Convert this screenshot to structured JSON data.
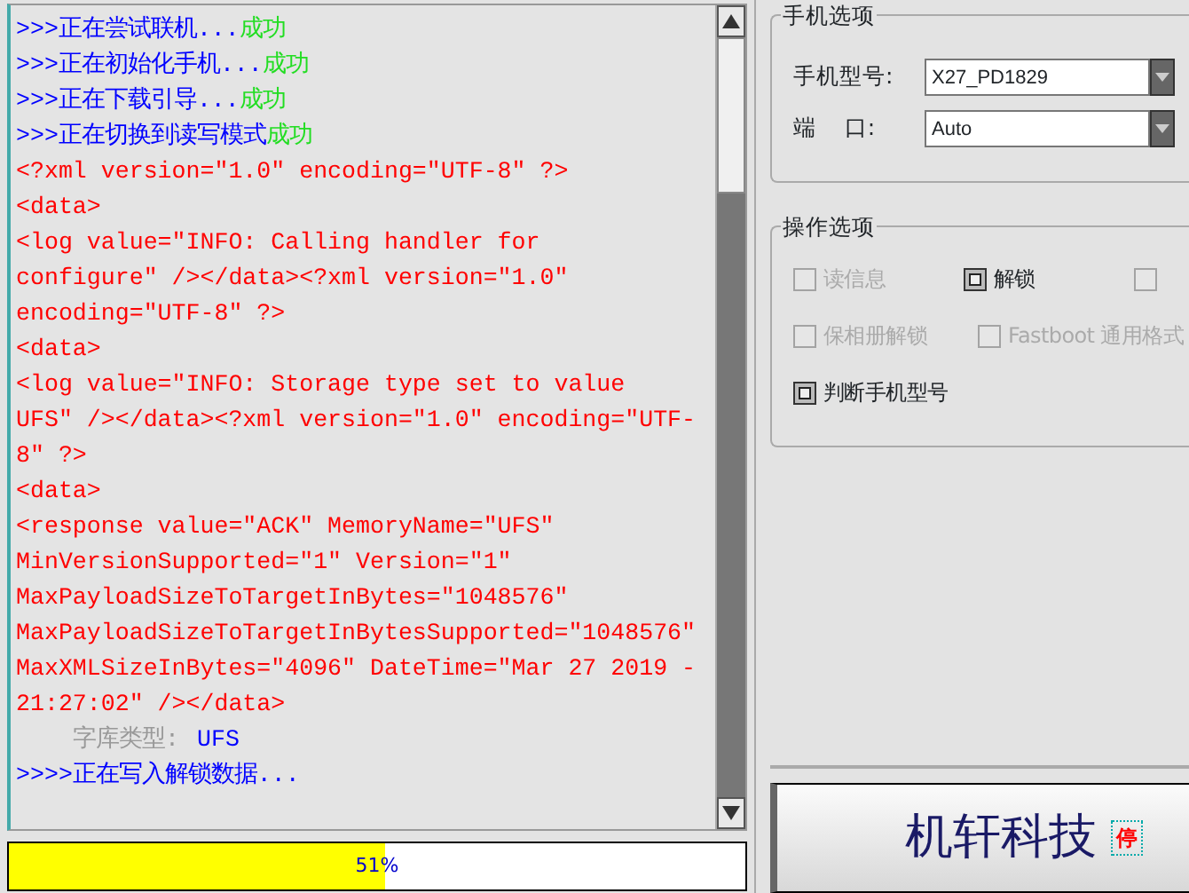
{
  "log": [
    {
      "segments": [
        {
          "kind": "prompt",
          "text": ">>>正在尝试联机..."
        },
        {
          "kind": "ok",
          "text": "成功"
        }
      ]
    },
    {
      "segments": [
        {
          "kind": "prompt",
          "text": ">>>正在初始化手机..."
        },
        {
          "kind": "ok",
          "text": "成功"
        }
      ]
    },
    {
      "segments": [
        {
          "kind": "prompt",
          "text": ">>>正在下载引导..."
        },
        {
          "kind": "ok",
          "text": "成功"
        }
      ]
    },
    {
      "segments": [
        {
          "kind": "prompt",
          "text": ">>>正在切换到读写模式"
        },
        {
          "kind": "ok",
          "text": "成功"
        }
      ]
    },
    {
      "segments": [
        {
          "kind": "xml",
          "text": "<?xml version=\"1.0\" encoding=\"UTF-8\" ?>"
        }
      ]
    },
    {
      "segments": [
        {
          "kind": "xml",
          "text": "<data>"
        }
      ]
    },
    {
      "segments": [
        {
          "kind": "xml",
          "text": "<log value=\"INFO: Calling handler for"
        }
      ]
    },
    {
      "segments": [
        {
          "kind": "xml",
          "text": "configure\" /></data><?xml version=\"1.0\""
        }
      ]
    },
    {
      "segments": [
        {
          "kind": "xml",
          "text": "encoding=\"UTF-8\" ?>"
        }
      ]
    },
    {
      "segments": [
        {
          "kind": "xml",
          "text": "<data>"
        }
      ]
    },
    {
      "segments": [
        {
          "kind": "xml",
          "text": "<log value=\"INFO: Storage type set to value"
        }
      ]
    },
    {
      "segments": [
        {
          "kind": "xml",
          "text": "UFS\" /></data><?xml version=\"1.0\" encoding=\"UTF-"
        }
      ]
    },
    {
      "segments": [
        {
          "kind": "xml",
          "text": "8\" ?>"
        }
      ]
    },
    {
      "segments": [
        {
          "kind": "xml",
          "text": "<data>"
        }
      ]
    },
    {
      "segments": [
        {
          "kind": "xml",
          "text": "<response value=\"ACK\" MemoryName=\"UFS\""
        }
      ]
    },
    {
      "segments": [
        {
          "kind": "xml",
          "text": "MinVersionSupported=\"1\" Version=\"1\""
        }
      ]
    },
    {
      "segments": [
        {
          "kind": "xml",
          "text": "MaxPayloadSizeToTargetInBytes=\"1048576\""
        }
      ]
    },
    {
      "segments": [
        {
          "kind": "xml",
          "text": "MaxPayloadSizeToTargetInBytesSupported=\"1048576\""
        }
      ]
    },
    {
      "segments": [
        {
          "kind": "xml",
          "text": "MaxXMLSizeInBytes=\"4096\" DateTime=\"Mar 27 2019 -"
        }
      ]
    },
    {
      "segments": [
        {
          "kind": "xml",
          "text": "21:27:02\" /></data>"
        }
      ]
    },
    {
      "segments": [
        {
          "kind": "label",
          "text": "字库类型:"
        },
        {
          "kind": "value",
          "text": "UFS"
        }
      ]
    },
    {
      "segments": [
        {
          "kind": "prompt",
          "text": ">>>>正在写入解锁数据..."
        }
      ]
    }
  ],
  "progress": {
    "level": 0.51,
    "reading": "51%"
  },
  "phone_options": {
    "title": "手机选项",
    "fields": [
      {
        "label": "手机型号:",
        "value": "X27_PD1829"
      },
      {
        "label": "端    口:",
        "value": "Auto"
      }
    ]
  },
  "operation_options": {
    "title": "操作选项",
    "rows": [
      [
        {
          "label": "读信息",
          "checked": false,
          "disabled": true
        },
        {
          "label": "解锁",
          "checked": true,
          "disabled": false
        },
        {
          "checked": false,
          "disabled": true
        }
      ],
      [
        {
          "label": "保相册解锁",
          "checked": false,
          "disabled": true
        },
        {
          "label": "Fastboot 通用格式",
          "checked": false,
          "disabled": true
        }
      ],
      [
        {
          "label": "判断手机型号",
          "checked": true,
          "disabled": false
        }
      ]
    ]
  },
  "start_button": {
    "label": "机轩科技",
    "badge": "停"
  }
}
